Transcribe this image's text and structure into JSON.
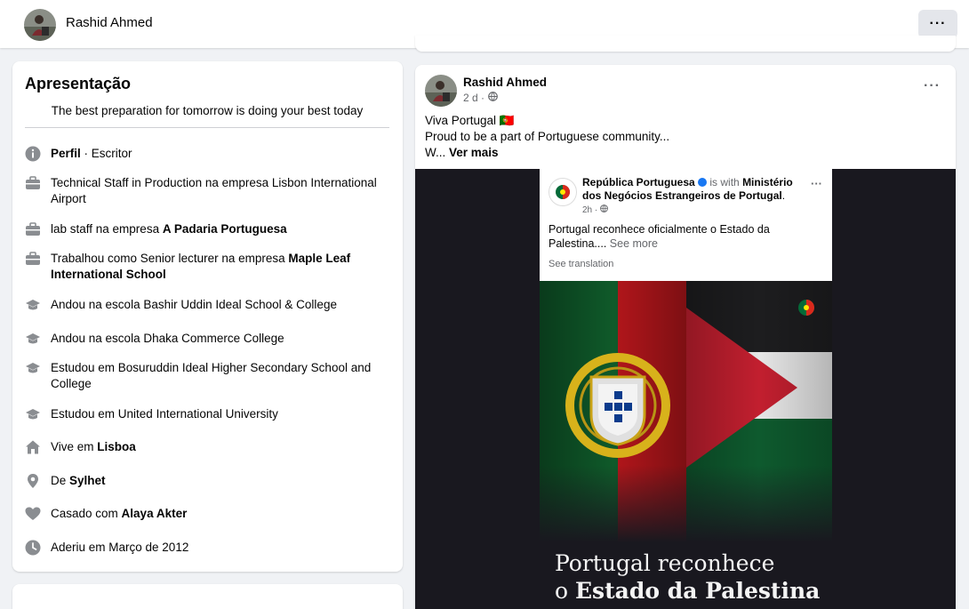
{
  "profile": {
    "name": "Rashid Ahmed"
  },
  "topbar": {
    "more_label": "···"
  },
  "intro": {
    "title": "Apresentação",
    "bio": "The best preparation for tomorrow is doing your best today",
    "items": [
      {
        "icon": "info-icon",
        "prefix": "",
        "bold": "Perfil",
        "suffix": " · Escritor"
      },
      {
        "icon": "briefcase-icon",
        "prefix": "Technical Staff in Production na empresa Lisbon International Airport",
        "bold": "",
        "suffix": ""
      },
      {
        "icon": "briefcase-icon",
        "prefix": "lab staff na empresa ",
        "bold": "A Padaria Portuguesa",
        "suffix": ""
      },
      {
        "icon": "briefcase-icon",
        "prefix": "Trabalhou como Senior lecturer na empresa ",
        "bold": "Maple Leaf International School",
        "suffix": ""
      },
      {
        "icon": "graduation-cap-icon",
        "prefix": "Andou na escola Bashir Uddin Ideal School & College",
        "bold": "",
        "suffix": ""
      },
      {
        "icon": "graduation-cap-icon",
        "prefix": "Andou na escola Dhaka Commerce College",
        "bold": "",
        "suffix": ""
      },
      {
        "icon": "graduation-cap-icon",
        "prefix": "Estudou em Bosuruddin Ideal Higher Secondary School and College",
        "bold": "",
        "suffix": ""
      },
      {
        "icon": "graduation-cap-icon",
        "prefix": "Estudou em United International University",
        "bold": "",
        "suffix": ""
      },
      {
        "icon": "home-icon",
        "prefix": "Vive em ",
        "bold": "Lisboa",
        "suffix": ""
      },
      {
        "icon": "location-pin-icon",
        "prefix": "De ",
        "bold": "Sylhet",
        "suffix": ""
      },
      {
        "icon": "heart-icon",
        "prefix": "Casado com ",
        "bold": "Alaya Akter",
        "suffix": ""
      },
      {
        "icon": "clock-icon",
        "prefix": "Aderiu em Março de 2012",
        "bold": "",
        "suffix": ""
      }
    ]
  },
  "post": {
    "author": "Rashid Ahmed",
    "time": "2 d ·",
    "privacy_icon": "globe-icon",
    "line1": "Viva Portugal 🇵🇹",
    "line2": "Proud to be a part of Portuguese community...",
    "line3_prefix": "W... ",
    "see_more": "Ver mais",
    "shared": {
      "page_name": "República Portuguesa",
      "with_text": " is with ",
      "with_page": "Ministério dos Negócios Estrangeiros de Portugal",
      "time": "2h ·",
      "body": "Portugal reconhece oficialmente o Estado da Palestina.... ",
      "see_more": "See more",
      "translation": "See translation",
      "headline_line1": "Portugal reconhece",
      "headline_line2_prefix": "o ",
      "headline_line2_bold": "Estado da Palestina"
    }
  },
  "colors": {
    "accent": "#1877f2",
    "muted": "#65676b",
    "bg": "#f0f2f5"
  }
}
